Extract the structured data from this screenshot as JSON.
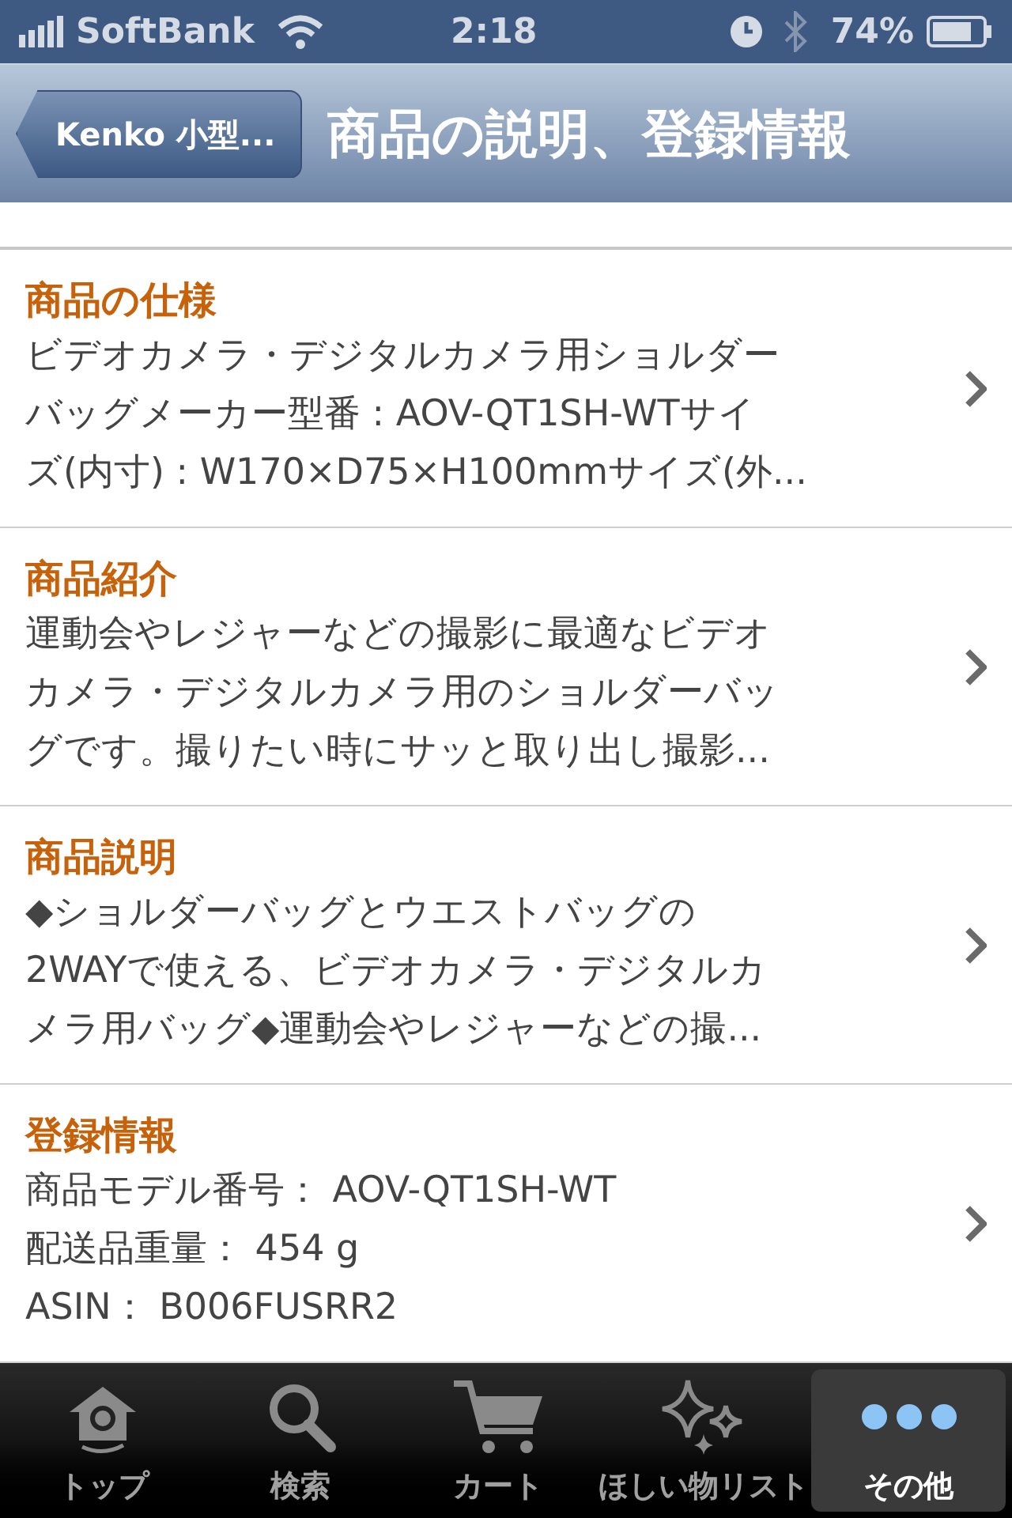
{
  "status_bar": {
    "carrier": "SoftBank",
    "time": "2:18",
    "battery": "74%"
  },
  "nav_bar": {
    "back": "Kenko 小型...",
    "title": "商品の説明、登録情報"
  },
  "sections": [
    {
      "title": "商品の仕様",
      "lines": [
        "ビデオカメラ・デジタルカメラ用ショルダー",
        "バッグメーカー型番 : AOV-QT1SH-WTサイ",
        "ズ(内寸) : W170×D75×H100mmサイズ(外..."
      ]
    },
    {
      "title": "商品紹介",
      "lines": [
        "運動会やレジャーなどの撮影に最適なビデオ",
        "カメラ・デジタルカメラ用のショルダーバッ",
        "グです。撮りたい時にサッと取り出し撮影..."
      ]
    },
    {
      "title": "商品説明",
      "lines": [
        "◆ショルダーバッグとウエストバッグの",
        "2WAYで使える、ビデオカメラ・デジタルカ",
        "メラ用バッグ◆運動会やレジャーなどの撮..."
      ]
    },
    {
      "title": "登録情報",
      "lines": [
        "商品モデル番号： AOV-QT1SH-WT",
        "配送品重量： 454 g",
        "ASIN： B006FUSRR2"
      ]
    }
  ],
  "tab_bar": [
    {
      "kind": "home",
      "label": "トップ",
      "selected": false
    },
    {
      "kind": "search",
      "label": "検索",
      "selected": false
    },
    {
      "kind": "cart",
      "label": "カート",
      "selected": false
    },
    {
      "kind": "sparkle",
      "label": "ほしい物リスト",
      "selected": false
    },
    {
      "kind": "more",
      "label": "その他",
      "selected": true
    }
  ]
}
